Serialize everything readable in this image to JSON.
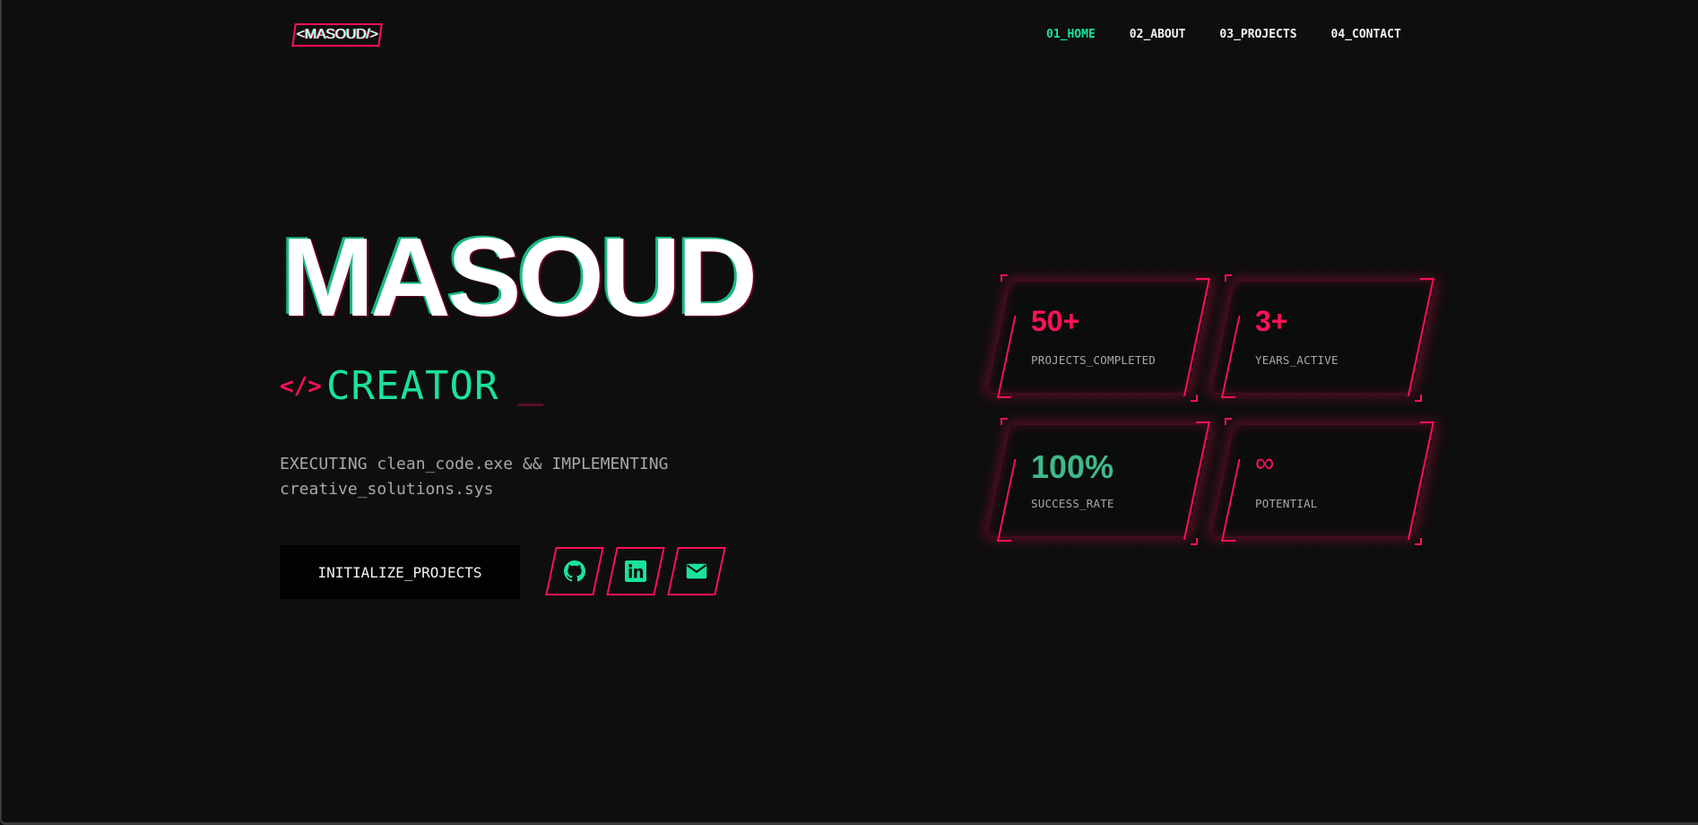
{
  "logo": {
    "text": "<MASOUD/>"
  },
  "nav": {
    "items": [
      {
        "label": "01_HOME",
        "active": true
      },
      {
        "label": "02_ABOUT",
        "active": false
      },
      {
        "label": "03_PROJECTS",
        "active": false
      },
      {
        "label": "04_CONTACT",
        "active": false
      }
    ]
  },
  "hero": {
    "title": "MASOUD",
    "role_icon": "</>",
    "role": "CREATOR",
    "tagline": "EXECUTING clean_code.exe && IMPLEMENTING creative_solutions.sys",
    "cta_label": "INITIALIZE_PROJECTS",
    "socials": [
      {
        "name": "github",
        "icon": "github-icon"
      },
      {
        "name": "linkedin",
        "icon": "linkedin-icon"
      },
      {
        "name": "email",
        "icon": "envelope-icon"
      }
    ]
  },
  "stats": [
    {
      "value": "50+",
      "label": "PROJECTS_COMPLETED"
    },
    {
      "value": "3+",
      "label": "YEARS_ACTIVE"
    },
    {
      "value": "100%",
      "label": "SUCCESS_RATE"
    },
    {
      "value": "∞",
      "label": "POTENTIAL"
    }
  ],
  "colors": {
    "accent_pink": "#ff1155",
    "accent_green": "#19e39a",
    "background": "#0e0e0e"
  }
}
